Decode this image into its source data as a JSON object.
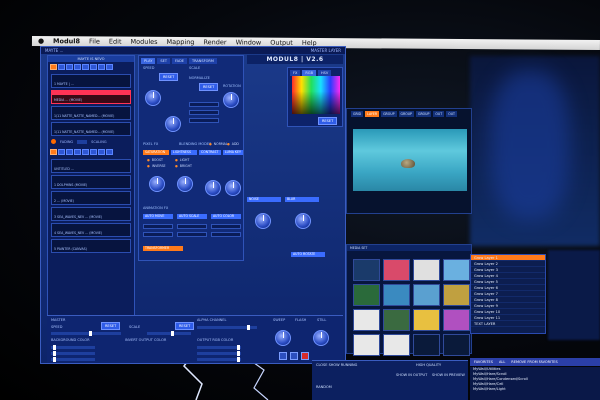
{
  "menubar": {
    "apple": "",
    "app_name": "Modul8",
    "items": [
      "File",
      "Edit",
      "Modules",
      "Mapping",
      "Render",
      "Window",
      "Output",
      "Help"
    ]
  },
  "window": {
    "left_header": "MAYTE ...",
    "logo": "MODUL8 | V2.6",
    "right_header": "MASTER LAYER"
  },
  "media_panel": {
    "header": "MAYTE IS NEVO",
    "layers": [
      "1  MAYTE | ...",
      "MEDIA ... (MOVIE)",
      "1/11  NATTE_NATTE_NAMED... (MOVIE)",
      "1/11  NATTE_NATTE_NAMED... (MOVIE)",
      "UNTITLED ...",
      "1  DOLPHINS (MOVIE)",
      "2  ... (MOVIE)",
      "3  SEA_WAVES_NEV ... (MOVIE)",
      "4  SEA_WAVES_NEV ... (MOVIE)",
      "5  PAINTER (CANVAS)"
    ],
    "toggle_a": "FADING",
    "toggle_b": "SCALING"
  },
  "control_panel": {
    "tabs": [
      "PLAY",
      "SET",
      "FADE"
    ],
    "transform_tab": "TRANSFORM",
    "speed_label": "SPEED",
    "scale_label": "SCALE",
    "normalize_label": "NORMALIZE",
    "rotation_label": "ROTATION",
    "reset": "RESET",
    "pixel_fx": "PIXEL FX",
    "blending": "BLENDING MODES",
    "normal": "NORMAL",
    "add": "ADD",
    "sub": "SUB",
    "saturation": "SATURATION",
    "lightness": "LIGHTNESS",
    "contrast": "CONTRAST",
    "luma_key": "LUMA KEY",
    "noise": "NOISE",
    "blur": "BLUR",
    "opts": [
      "BOOST",
      "INVERSE",
      "LIGHT",
      "BRIGHT"
    ],
    "animation_fx": "ANIMATION FX",
    "auto_move": "AUTO MOVE",
    "auto_scale": "AUTO SCALE",
    "auto_color": "AUTO COLOR",
    "auto_rotate": "AUTO ROTATE",
    "transformer": "TRANSFORMER"
  },
  "palette": {
    "tabs": [
      "FX",
      "RGB",
      "HSV"
    ],
    "reset": "RESET"
  },
  "bottom": {
    "master": "MASTER",
    "speed": "SPEED",
    "scale": "SCALE",
    "alpha_channel": "ALPHA CHANNEL",
    "reset": "RESET",
    "background_color": "BACKGROUND COLOR",
    "invert_output_color": "INVERT OUTPUT COLOR",
    "output_rgb_color": "OUTPUT RGB COLOR",
    "sweep": "SWEEP",
    "flash": "FLASH",
    "still": "STILL"
  },
  "preview": {
    "tabs": [
      "GRID",
      "LAYER",
      "GROUP",
      "GROUP",
      "GROUP",
      "OUT",
      "OUT"
    ]
  },
  "media_browser": {
    "header": "MEDIA SET",
    "thumb_colors": [
      "#1a3a6a",
      "#d94a6a",
      "#e0e0e0",
      "#6ab0e0",
      "#2a6a3a",
      "#3a8ac0",
      "#5aa0d0",
      "#c0a040",
      "#e8e8e8",
      "#3a6a40",
      "#e8c040",
      "#b050c0",
      "#e8e8e8",
      "#e8e8e8",
      "#0a1a3a",
      "#0a1a3a"
    ]
  },
  "layer_list": {
    "rows": [
      "Grow Layer 1",
      "Grow Layer 2",
      "Grow Layer 3",
      "Grow Layer 4",
      "Grow Layer 5",
      "Grow Layer 6",
      "Grow Layer 7",
      "Grow Layer 8",
      "Grow Layer 9",
      "Grow Layer 10",
      "Grow Layer 11"
    ],
    "selected_index": 0,
    "footer": "TEXT LAYER"
  },
  "favorites": {
    "tabs": [
      "FAVORITES",
      "ALL",
      "REMOVE FROM FAVORITES"
    ],
    "rows": [
      "MyWall/Utilities",
      "MyWall/Hare/Scroll",
      "MyWall/Hare/Condensed/Scroll",
      "MyWall/Hare/Cell",
      "MyWall/Hare/Light"
    ]
  },
  "bottom_mid": {
    "high_quality": "HIGH QUALITY",
    "show_in_output": "SHOW IN OUTPUT",
    "show_in_preview": "SHOW IN PREVIEW",
    "random": "RANDOM",
    "close_show": "CLOSE SHOW RUNNING"
  },
  "colors": {
    "accent_orange": "#ff7a1a",
    "ui_blue": "#1b3a8a",
    "selected_red": "#ff3355"
  }
}
